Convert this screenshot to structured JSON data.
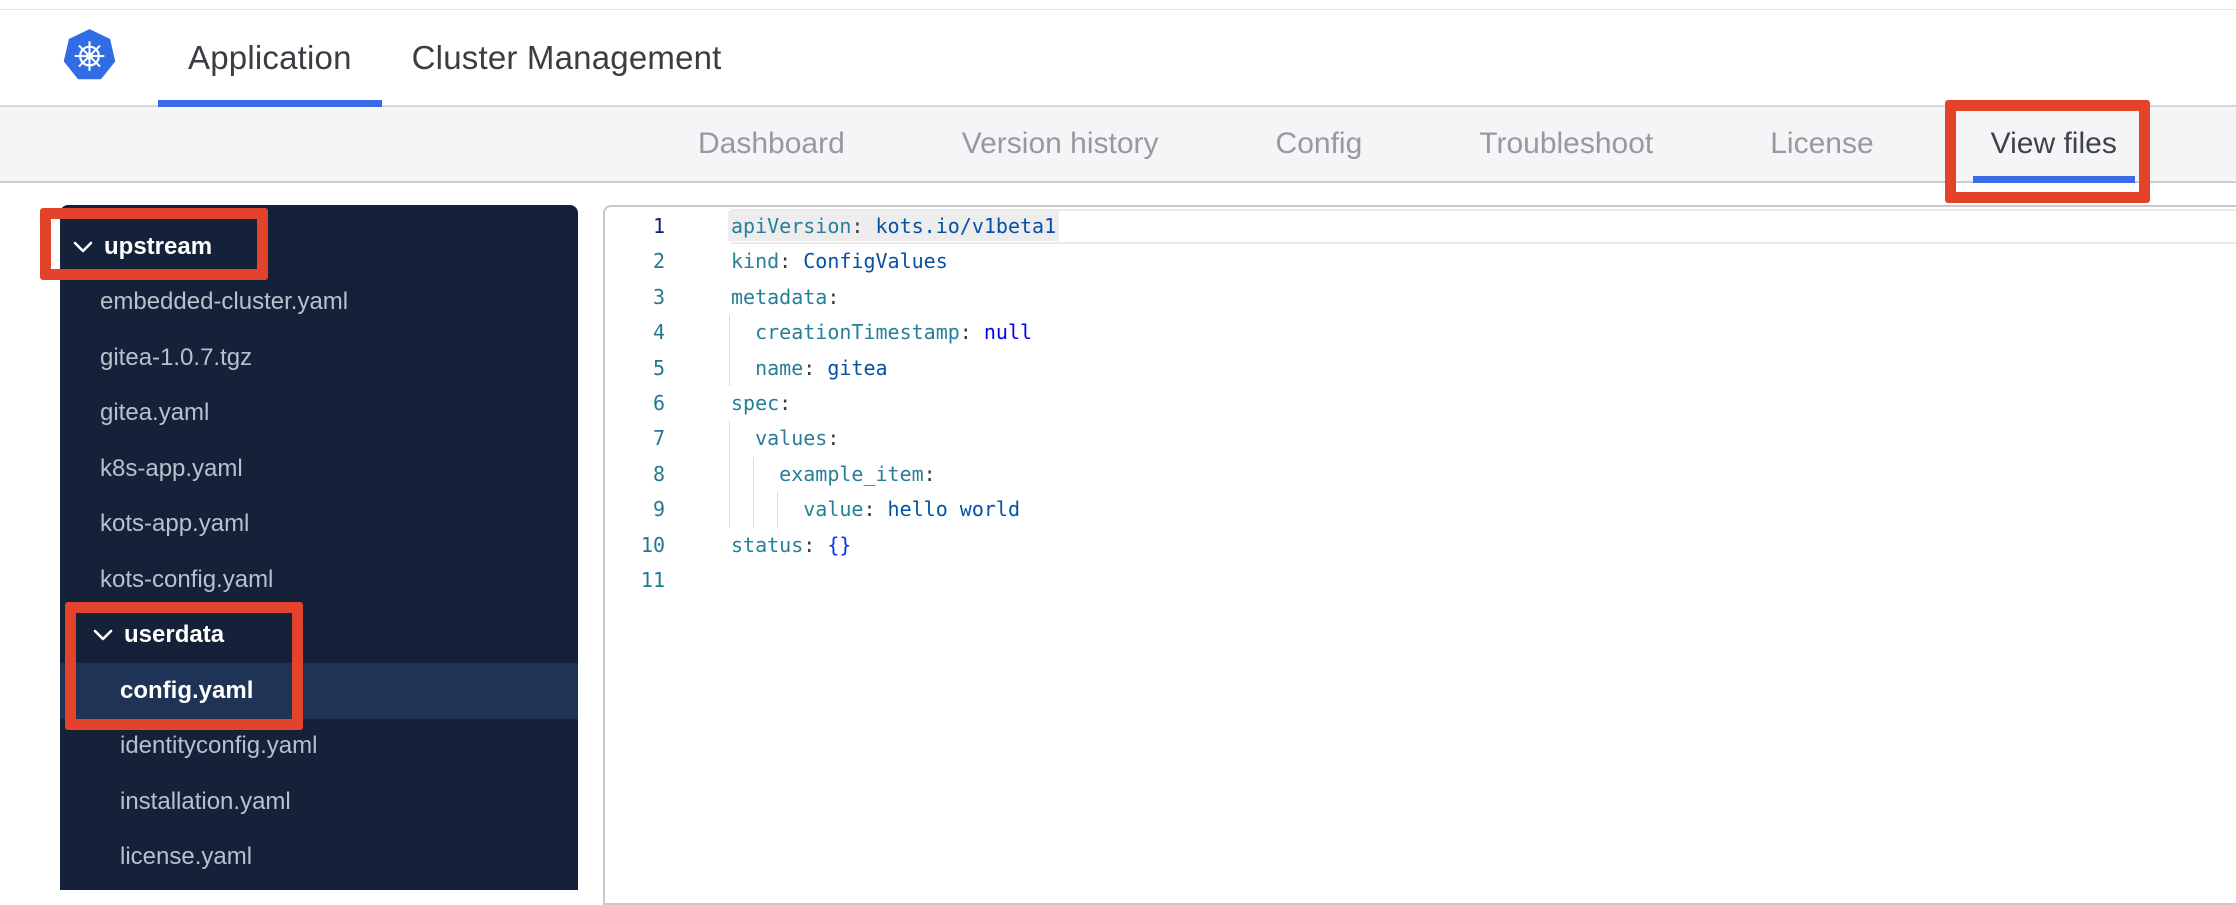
{
  "header": {
    "tabs": [
      {
        "label": "Application",
        "active": true
      },
      {
        "label": "Cluster Management",
        "active": false
      }
    ]
  },
  "subnav": {
    "tabs": [
      {
        "label": "Dashboard",
        "active": false
      },
      {
        "label": "Version history",
        "active": false
      },
      {
        "label": "Config",
        "active": false
      },
      {
        "label": "Troubleshoot",
        "active": false
      },
      {
        "label": "License",
        "active": false
      },
      {
        "label": "View files",
        "active": true
      }
    ]
  },
  "sidebar": {
    "items": [
      {
        "label": "upstream",
        "type": "folder",
        "level": 1,
        "expanded": true
      },
      {
        "label": "embedded-cluster.yaml",
        "type": "file",
        "level": 1
      },
      {
        "label": "gitea-1.0.7.tgz",
        "type": "file",
        "level": 1
      },
      {
        "label": "gitea.yaml",
        "type": "file",
        "level": 1
      },
      {
        "label": "k8s-app.yaml",
        "type": "file",
        "level": 1
      },
      {
        "label": "kots-app.yaml",
        "type": "file",
        "level": 1
      },
      {
        "label": "kots-config.yaml",
        "type": "file",
        "level": 1
      },
      {
        "label": "userdata",
        "type": "folder",
        "level": 2,
        "expanded": true
      },
      {
        "label": "config.yaml",
        "type": "file",
        "level": 2,
        "selected": true
      },
      {
        "label": "identityconfig.yaml",
        "type": "file",
        "level": 2
      },
      {
        "label": "installation.yaml",
        "type": "file",
        "level": 2
      },
      {
        "label": "license.yaml",
        "type": "file",
        "level": 2
      }
    ]
  },
  "editor": {
    "language": "yaml",
    "current_line": 1,
    "lines": [
      {
        "num": "1",
        "segs": [
          {
            "c": "key",
            "t": "apiVersion"
          },
          {
            "c": "pu",
            "t": ": "
          },
          {
            "c": "str",
            "t": "kots.io/v1beta1"
          }
        ]
      },
      {
        "num": "2",
        "segs": [
          {
            "c": "key",
            "t": "kind"
          },
          {
            "c": "pu",
            "t": ": "
          },
          {
            "c": "str",
            "t": "ConfigValues"
          }
        ]
      },
      {
        "num": "3",
        "segs": [
          {
            "c": "key",
            "t": "metadata"
          },
          {
            "c": "pu",
            "t": ":"
          }
        ]
      },
      {
        "num": "4",
        "segs": [
          {
            "c": "key",
            "t": "  creationTimestamp"
          },
          {
            "c": "pu",
            "t": ": "
          },
          {
            "c": "kw",
            "t": "null"
          }
        ]
      },
      {
        "num": "5",
        "segs": [
          {
            "c": "key",
            "t": "  name"
          },
          {
            "c": "pu",
            "t": ": "
          },
          {
            "c": "str",
            "t": "gitea"
          }
        ]
      },
      {
        "num": "6",
        "segs": [
          {
            "c": "key",
            "t": "spec"
          },
          {
            "c": "pu",
            "t": ":"
          }
        ]
      },
      {
        "num": "7",
        "segs": [
          {
            "c": "key",
            "t": "  values"
          },
          {
            "c": "pu",
            "t": ":"
          }
        ]
      },
      {
        "num": "8",
        "segs": [
          {
            "c": "key",
            "t": "    example_item"
          },
          {
            "c": "pu",
            "t": ":"
          }
        ]
      },
      {
        "num": "9",
        "segs": [
          {
            "c": "key",
            "t": "      value"
          },
          {
            "c": "pu",
            "t": ": "
          },
          {
            "c": "str",
            "t": "hello world"
          }
        ]
      },
      {
        "num": "10",
        "segs": [
          {
            "c": "key",
            "t": "status"
          },
          {
            "c": "pu",
            "t": ": "
          },
          {
            "c": "br",
            "t": "{}"
          }
        ]
      },
      {
        "num": "11",
        "segs": []
      }
    ]
  },
  "annotations": {
    "color": "#e2432a",
    "boxes": [
      "upstream-folder",
      "userdata-config-yaml",
      "view-files-tab"
    ]
  },
  "colors": {
    "accent_blue": "#3b6ce8",
    "kubernetes_blue": "#326ce5",
    "sidebar_bg": "#142139",
    "sidebar_selected_bg": "#1e3355",
    "subnav_bg": "#f4f5f7",
    "annotation_red": "#e2432a",
    "yaml_key": "#267f99",
    "yaml_string": "#0451a5",
    "yaml_keyword": "#0000ff"
  }
}
